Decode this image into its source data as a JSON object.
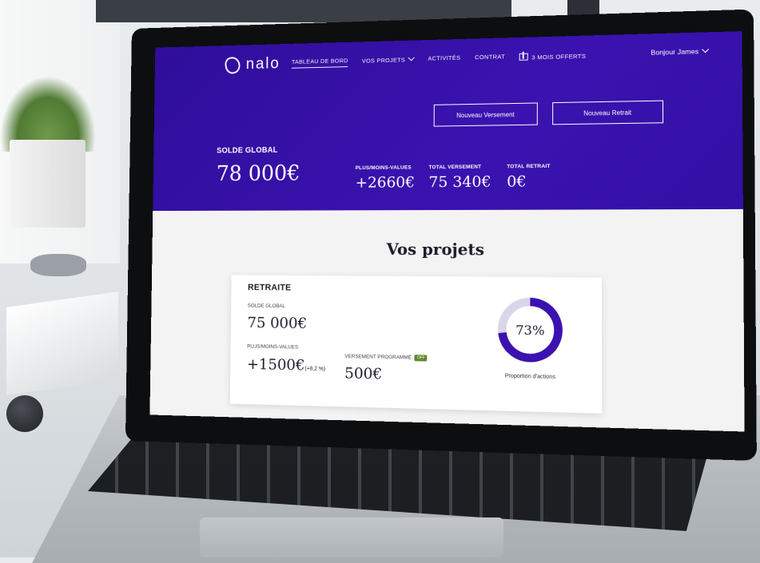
{
  "brand": {
    "name": "nalo"
  },
  "nav": {
    "items": [
      {
        "label": "TABLEAU DE BORD",
        "active": true
      },
      {
        "label": "VOS PROJETS",
        "dropdown": true
      },
      {
        "label": "ACTIVITÉS"
      },
      {
        "label": "CONTRAT"
      },
      {
        "label": "3 MOIS OFFERTS",
        "icon": "gift-icon"
      }
    ],
    "user_greeting": "Bonjour James"
  },
  "actions": {
    "new_deposit": "Nouveau Versement",
    "new_withdrawal": "Nouveau Retrait"
  },
  "summary": {
    "solde_label": "SOLDE GLOBAL",
    "solde_value": "78 000€",
    "plus_moins_label": "PLUS/MOINS-VALUES",
    "plus_moins_value": "+2660€",
    "total_versement_label": "TOTAL VERSEMENT",
    "total_versement_value": "75 340€",
    "total_retrait_label": "TOTAL RETRAIT",
    "total_retrait_value": "0€"
  },
  "projects": {
    "title": "Vos projets",
    "card": {
      "name": "RETRAITE",
      "solde_label": "SOLDE GLOBAL",
      "solde_value": "75 000€",
      "pmv_label": "PLUS/MOINS-VALUES",
      "pmv_value": "+1500€",
      "pmv_pct": "(+8,2 %)",
      "versement_label": "VERSEMENT PROGRAMMÉ",
      "versement_badge": "OFF",
      "versement_value": "500€",
      "proportion_value": 73,
      "proportion_text": "73%",
      "proportion_caption": "Proportion d'actions"
    }
  },
  "colors": {
    "brand_purple": "#3b12b0",
    "donut_track": "#d9d6e8",
    "badge_green": "#5c8a2a"
  }
}
